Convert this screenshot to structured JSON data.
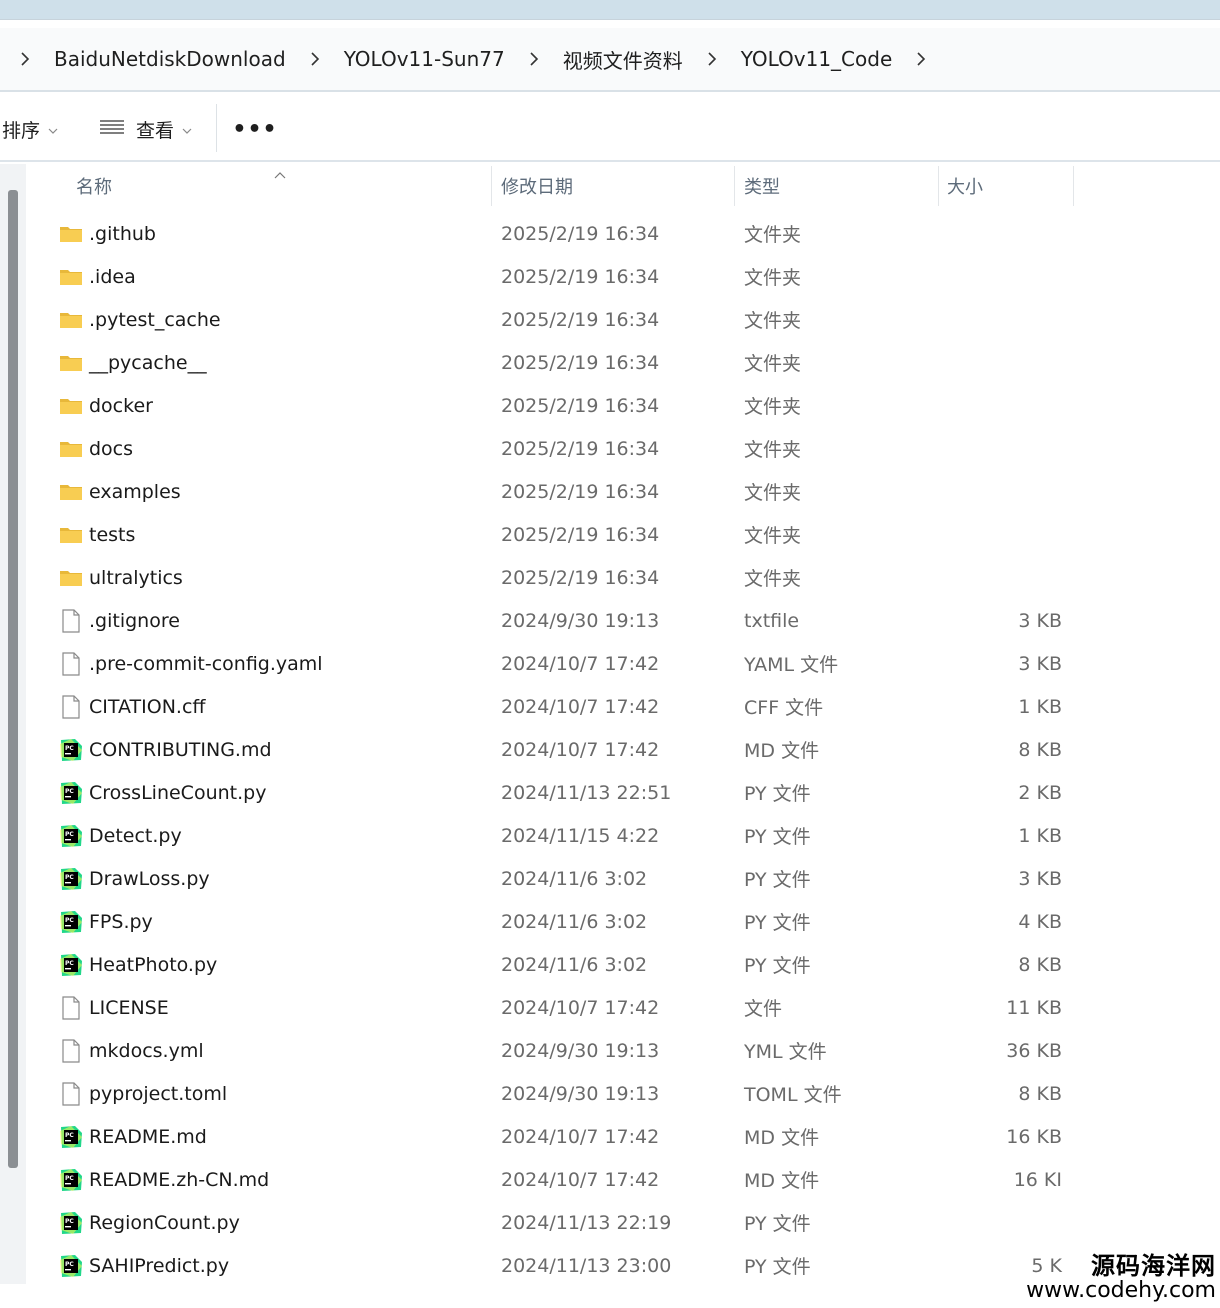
{
  "breadcrumb": [
    "BaiduNetdiskDownload",
    "YOLOv11-Sun77",
    "视频文件资料",
    "YOLOv11_Code"
  ],
  "toolbar": {
    "sort_label": "排序",
    "view_label": "查看",
    "more_label": "•••"
  },
  "columns": {
    "name": "名称",
    "date": "修改日期",
    "type": "类型",
    "size": "大小"
  },
  "files": [
    {
      "icon": "folder-icon",
      "name": ".github",
      "date": "2025/2/19 16:34",
      "type": "文件夹",
      "size": ""
    },
    {
      "icon": "folder-icon",
      "name": ".idea",
      "date": "2025/2/19 16:34",
      "type": "文件夹",
      "size": ""
    },
    {
      "icon": "folder-icon",
      "name": ".pytest_cache",
      "date": "2025/2/19 16:34",
      "type": "文件夹",
      "size": ""
    },
    {
      "icon": "folder-icon",
      "name": "__pycache__",
      "date": "2025/2/19 16:34",
      "type": "文件夹",
      "size": ""
    },
    {
      "icon": "folder-icon",
      "name": "docker",
      "date": "2025/2/19 16:34",
      "type": "文件夹",
      "size": ""
    },
    {
      "icon": "folder-icon",
      "name": "docs",
      "date": "2025/2/19 16:34",
      "type": "文件夹",
      "size": ""
    },
    {
      "icon": "folder-icon",
      "name": "examples",
      "date": "2025/2/19 16:34",
      "type": "文件夹",
      "size": ""
    },
    {
      "icon": "folder-icon",
      "name": "tests",
      "date": "2025/2/19 16:34",
      "type": "文件夹",
      "size": ""
    },
    {
      "icon": "folder-icon",
      "name": "ultralytics",
      "date": "2025/2/19 16:34",
      "type": "文件夹",
      "size": ""
    },
    {
      "icon": "file-icon",
      "name": ".gitignore",
      "date": "2024/9/30 19:13",
      "type": "txtfile",
      "size": "3 KB"
    },
    {
      "icon": "file-icon",
      "name": ".pre-commit-config.yaml",
      "date": "2024/10/7 17:42",
      "type": "YAML 文件",
      "size": "3 KB"
    },
    {
      "icon": "file-icon",
      "name": "CITATION.cff",
      "date": "2024/10/7 17:42",
      "type": "CFF 文件",
      "size": "1 KB"
    },
    {
      "icon": "pycharm-icon",
      "name": "CONTRIBUTING.md",
      "date": "2024/10/7 17:42",
      "type": "MD 文件",
      "size": "8 KB"
    },
    {
      "icon": "pycharm-icon",
      "name": "CrossLineCount.py",
      "date": "2024/11/13 22:51",
      "type": "PY 文件",
      "size": "2 KB"
    },
    {
      "icon": "pycharm-icon",
      "name": "Detect.py",
      "date": "2024/11/15 4:22",
      "type": "PY 文件",
      "size": "1 KB"
    },
    {
      "icon": "pycharm-icon",
      "name": "DrawLoss.py",
      "date": "2024/11/6 3:02",
      "type": "PY 文件",
      "size": "3 KB"
    },
    {
      "icon": "pycharm-icon",
      "name": "FPS.py",
      "date": "2024/11/6 3:02",
      "type": "PY 文件",
      "size": "4 KB"
    },
    {
      "icon": "pycharm-icon",
      "name": "HeatPhoto.py",
      "date": "2024/11/6 3:02",
      "type": "PY 文件",
      "size": "8 KB"
    },
    {
      "icon": "file-icon",
      "name": "LICENSE",
      "date": "2024/10/7 17:42",
      "type": "文件",
      "size": "11 KB"
    },
    {
      "icon": "file-icon",
      "name": "mkdocs.yml",
      "date": "2024/9/30 19:13",
      "type": "YML 文件",
      "size": "36 KB"
    },
    {
      "icon": "file-icon",
      "name": "pyproject.toml",
      "date": "2024/9/30 19:13",
      "type": "TOML 文件",
      "size": "8 KB"
    },
    {
      "icon": "pycharm-icon",
      "name": "README.md",
      "date": "2024/10/7 17:42",
      "type": "MD 文件",
      "size": "16 KB"
    },
    {
      "icon": "pycharm-icon",
      "name": "README.zh-CN.md",
      "date": "2024/10/7 17:42",
      "type": "MD 文件",
      "size": "16 KI"
    },
    {
      "icon": "pycharm-icon",
      "name": "RegionCount.py",
      "date": "2024/11/13 22:19",
      "type": "PY 文件",
      "size": ""
    },
    {
      "icon": "pycharm-icon",
      "name": "SAHIPredict.py",
      "date": "2024/11/13 23:00",
      "type": "PY 文件",
      "size": "5 K"
    }
  ],
  "watermark": {
    "line1": "源码海洋网",
    "line2": "www.codehy.com"
  },
  "colors": {
    "folder": "#f6c644",
    "pycharm_green": "#21d789",
    "header_text": "#5d6b7a"
  }
}
